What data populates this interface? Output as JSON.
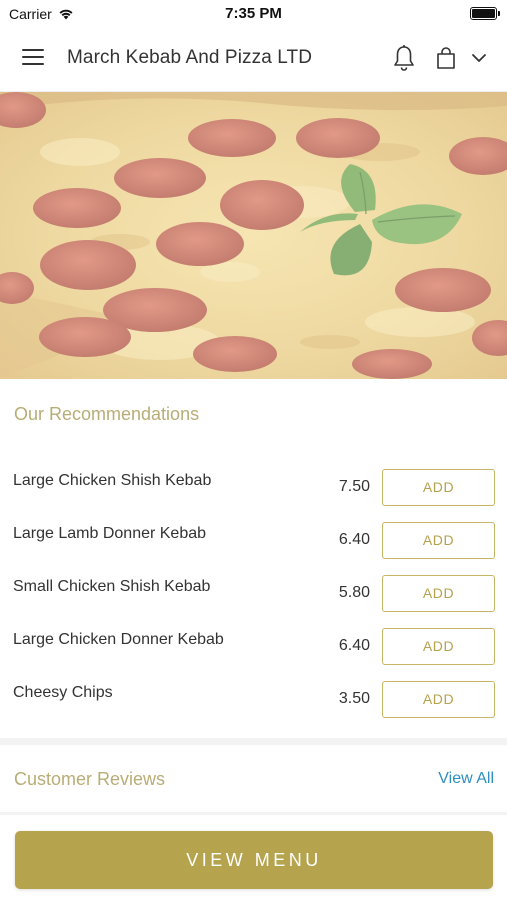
{
  "status_bar": {
    "carrier": "Carrier",
    "time": "7:35 PM"
  },
  "header": {
    "title": "March Kebab And Pizza LTD",
    "icons": [
      "hamburger-menu-icon",
      "bell-icon",
      "shopping-bag-icon",
      "chevron-down-icon"
    ]
  },
  "hero": {
    "image": "pepperoni-pizza-with-basil"
  },
  "recommendations": {
    "title": "Our Recommendations",
    "items": [
      {
        "name": "Large Chicken Shish Kebab",
        "price": "7.50",
        "button": "ADD"
      },
      {
        "name": "Large Lamb Donner Kebab",
        "price": "6.40",
        "button": "ADD"
      },
      {
        "name": "Small Chicken Shish Kebab",
        "price": "5.80",
        "button": "ADD"
      },
      {
        "name": "Large Chicken Donner Kebab",
        "price": "6.40",
        "button": "ADD"
      },
      {
        "name": "Cheesy Chips",
        "price": "3.50",
        "button": "ADD"
      }
    ]
  },
  "reviews": {
    "title": "Customer Reviews",
    "view_all": "View All"
  },
  "footer": {
    "view_menu": "VIEW MENU"
  },
  "colors": {
    "accent_gold": "#b5a34e",
    "section_title": "#b8ad76",
    "link_blue": "#2e8fc0"
  }
}
